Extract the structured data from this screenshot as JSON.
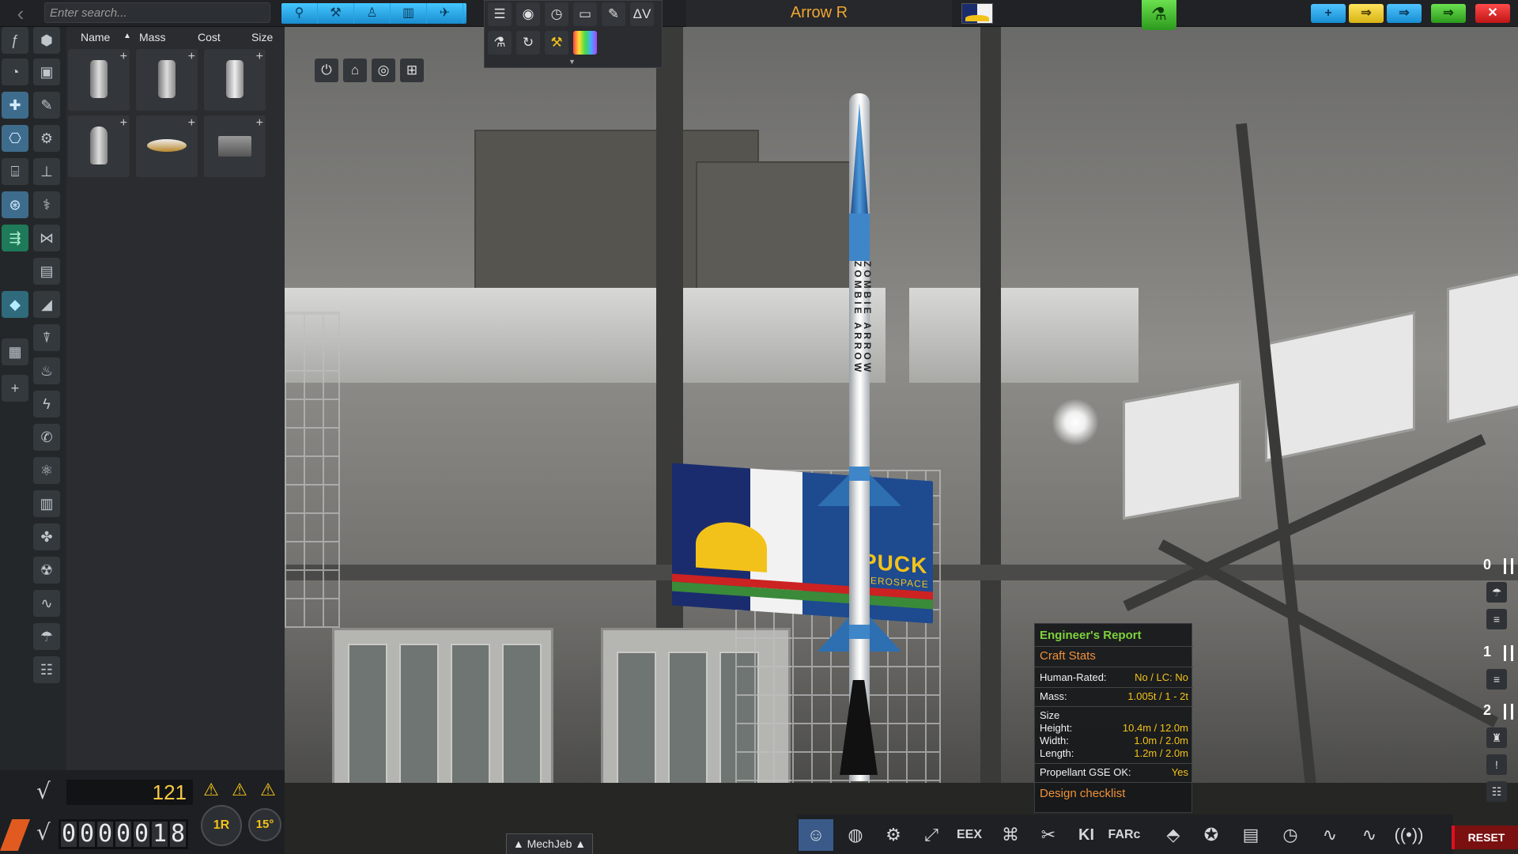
{
  "topbar": {
    "search_placeholder": "Enter search...",
    "craft_name": "Arrow R",
    "editor_mode_icons": [
      "crew-icon",
      "wrench-icon",
      "person-icon",
      "cargo-icon",
      "plane-icon"
    ],
    "tool_icons_row1": [
      "list-icon",
      "sphere-icon",
      "clock-icon",
      "engine-icon",
      "brush-icon"
    ],
    "delta_v_label": "ΔV",
    "tool_icons_row2": [
      "flask-icon",
      "refresh-icon",
      "wrench-icon",
      "rainbow-icon"
    ],
    "plus_symbol": "+",
    "colors": {
      "accent_blue": "#2aa0e0",
      "science_green": "#3fbf2a",
      "craft_name": "#f0a532"
    }
  },
  "parts_panel": {
    "columns": [
      "Name",
      "Mass",
      "Cost",
      "Size"
    ],
    "sort_indicator": "▲",
    "part_count": 6,
    "plus_symbol": "+"
  },
  "bottom_left": {
    "science": "121",
    "funds_digits": [
      "0",
      "0",
      "0",
      "0",
      "0",
      "1",
      "8"
    ],
    "rotate_label": "1R",
    "angle_label": "15°"
  },
  "mechjeb": {
    "label": "▲ MechJeb ▲"
  },
  "engineers_report": {
    "title": "Engineer's Report",
    "section_craft": "Craft Stats",
    "human_rated_label": "Human-Rated:",
    "human_rated_value": "No / LC: No",
    "mass_label": "Mass:",
    "mass_value": "1.005t / 1 - 2t",
    "size_label": "Size",
    "height_label": "Height:",
    "height_value": "10.4m / 12.0m",
    "width_label": "Width:",
    "width_value": "1.0m / 2.0m",
    "length_label": "Length:",
    "length_value": "1.2m / 2.0m",
    "propellant_label": "Propellant GSE OK:",
    "propellant_value": "Yes",
    "section_checklist": "Design checklist"
  },
  "stages": [
    "0",
    "1",
    "2"
  ],
  "bottom_toolbar": {
    "eex_label": "EEX",
    "farc_label": "FARc",
    "ki_label": "KI",
    "reset_label": "RESET"
  },
  "hangar": {
    "banner_text": "PUCK",
    "banner_sub": "AEROSPACE",
    "rocket_text_1": "ZOMBIE ARROW",
    "rocket_text_2": "ZOMBIE ARROW"
  }
}
